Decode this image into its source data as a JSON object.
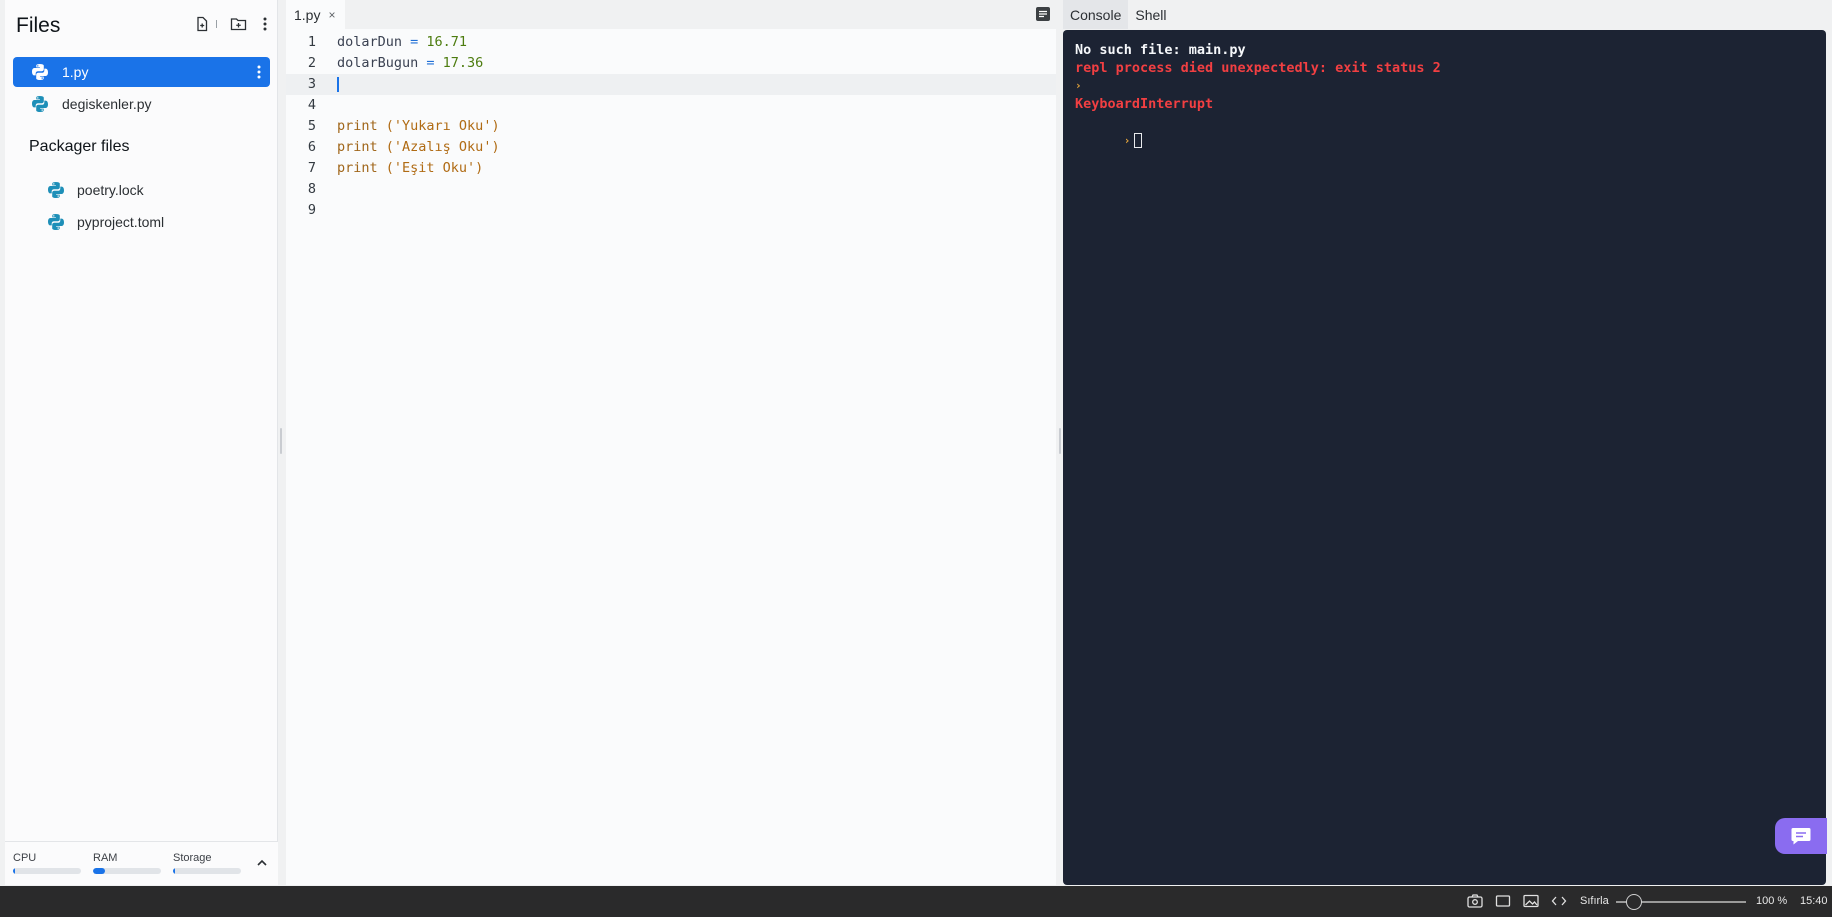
{
  "sidebar": {
    "title": "Files",
    "header_icons": [
      "new-file-icon",
      "new-folder-icon",
      "more-vertical-icon"
    ],
    "files": [
      {
        "name": "1.py",
        "active": true
      },
      {
        "name": "degiskenler.py",
        "active": false
      }
    ],
    "packager_title": "Packager files",
    "packager_files": [
      {
        "name": "poetry.lock"
      },
      {
        "name": "pyproject.toml"
      }
    ],
    "resources": [
      {
        "label": "CPU",
        "usage": 0.03
      },
      {
        "label": "RAM",
        "usage": 0.18
      },
      {
        "label": "Storage",
        "usage": 0.03
      }
    ]
  },
  "editor": {
    "tab_label": "1.py",
    "tab_close": "×",
    "lines": [
      {
        "n": "1",
        "tokens": [
          {
            "t": "dolarDun",
            "k": "id"
          },
          {
            "t": " = ",
            "k": "op"
          },
          {
            "t": "16.71",
            "k": "num"
          }
        ]
      },
      {
        "n": "2",
        "tokens": [
          {
            "t": "dolarBugun",
            "k": "id"
          },
          {
            "t": " = ",
            "k": "op"
          },
          {
            "t": "17.36",
            "k": "num"
          }
        ]
      },
      {
        "n": "3",
        "tokens": [],
        "current": true
      },
      {
        "n": "4",
        "tokens": []
      },
      {
        "n": "5",
        "tokens": [
          {
            "t": "print ",
            "k": "fn"
          },
          {
            "t": "('Yukarı Oku')",
            "k": "str"
          }
        ]
      },
      {
        "n": "6",
        "tokens": [
          {
            "t": "print ",
            "k": "fn"
          },
          {
            "t": "('Azalış Oku')",
            "k": "str"
          }
        ]
      },
      {
        "n": "7",
        "tokens": [
          {
            "t": "print ",
            "k": "fn"
          },
          {
            "t": "('Eşit Oku')",
            "k": "str"
          }
        ]
      },
      {
        "n": "8",
        "tokens": []
      },
      {
        "n": "9",
        "tokens": []
      }
    ]
  },
  "console": {
    "tabs": [
      {
        "label": "Console",
        "active": true
      },
      {
        "label": "Shell",
        "active": false
      }
    ],
    "lines": [
      {
        "text": "No such file: main.py",
        "style": "white"
      },
      {
        "text": "repl process died unexpectedly: exit status 2",
        "style": "red"
      },
      {
        "text": "›",
        "style": "prompt"
      },
      {
        "text": "KeyboardInterrupt",
        "style": "red"
      }
    ],
    "prompt_symbol": "›"
  },
  "statusbar": {
    "zoom_label": "Sıfırla",
    "zoom_value": "100 %",
    "zoom_level": 0.14,
    "clock": "15:40"
  },
  "colors": {
    "accent": "#1a73e8",
    "console_bg": "#1c2333",
    "error": "#f23f42",
    "chat": "#8a6cf0"
  }
}
